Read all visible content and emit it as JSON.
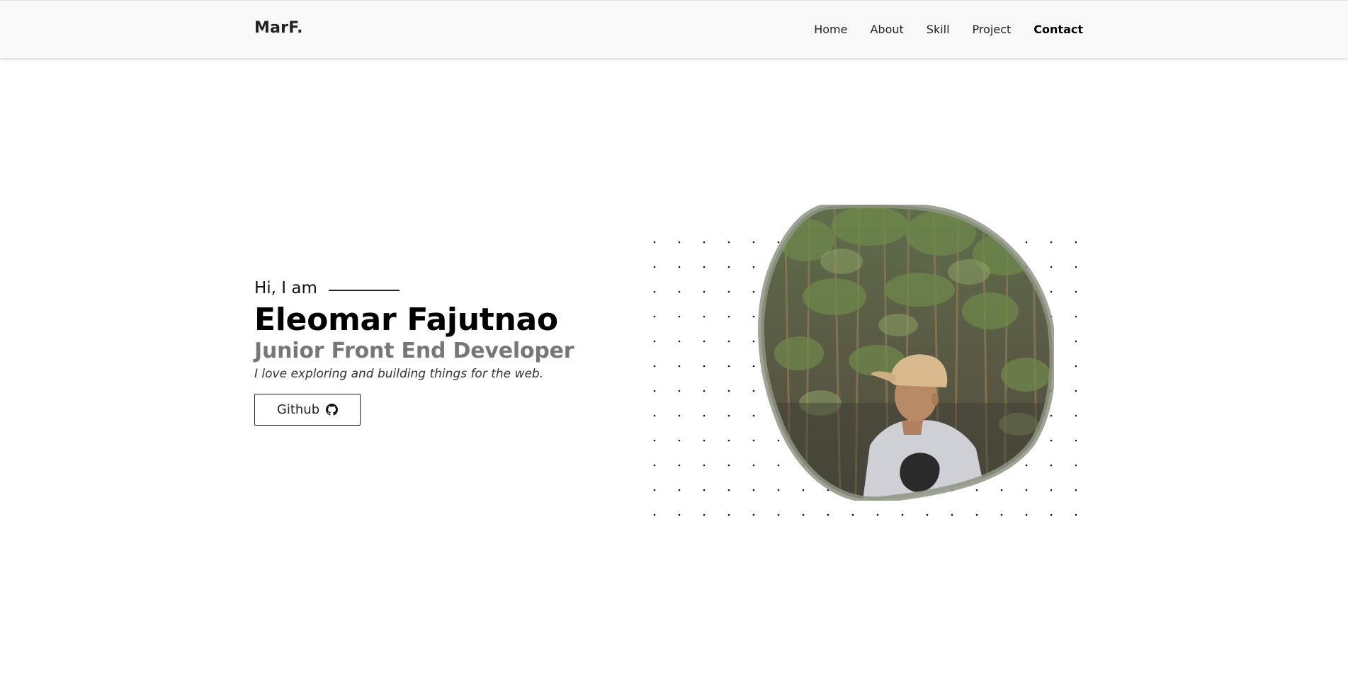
{
  "nav": {
    "brand": "MarF.",
    "links": [
      {
        "label": "Home"
      },
      {
        "label": "About"
      },
      {
        "label": "Skill"
      },
      {
        "label": "Project"
      },
      {
        "label": "Contact"
      }
    ]
  },
  "hero": {
    "greeting": "Hi, I am",
    "name": "Eleomar Fajutnao",
    "role": "Junior Front End Developer",
    "tagline": "I love exploring and building things for the web.",
    "github_label": "Github"
  },
  "icons": {
    "github": "github-icon"
  }
}
